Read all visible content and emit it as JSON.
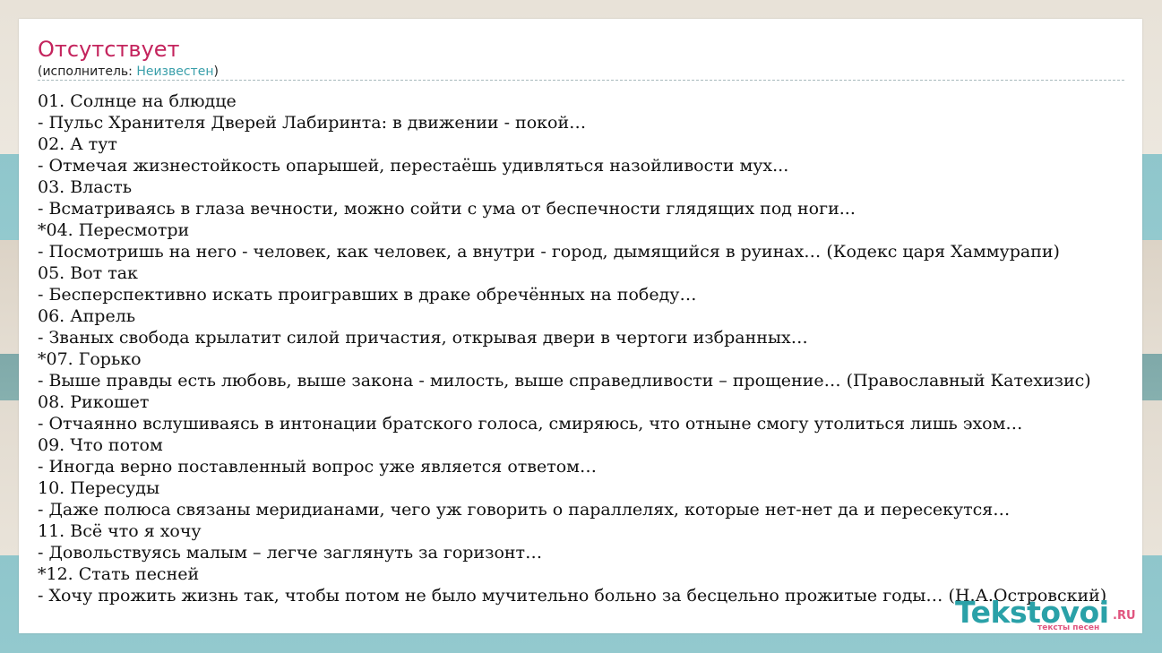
{
  "page": {
    "title": "Отсутствует",
    "artist_prefix": "(исполнитель: ",
    "artist_name": "Неизвестен",
    "artist_suffix": ")"
  },
  "tracks": [
    "01. Солнце на блюдце",
    "- Пульс Хранителя Дверей Лабиринта: в движении - покой…",
    "02. А тут",
    "- Отмечая жизнестойкость опарышей, перестаёшь удивляться назойливости мух...",
    "03. Власть",
    "- Всматриваясь в глаза вечности, можно сойти с ума от беспечности глядящих под ноги...",
    "*04. Пересмотри",
    "- Посмотришь на него - человек, как человек, а внутри - город, дымящийся в руинах… (Кодекс царя Хаммурапи)",
    "05. Вот так",
    "- Бесперспективно искать проигравших в драке обречённых на победу…",
    "06. Апрель",
    "- Званых свобода крылатит силой причастия, открывая двери в чертоги избранных…",
    "*07. Горько",
    "- Выше правды есть любовь, выше закона - милость, выше справедливости – прощение… (Православный Катехизис)",
    "08. Рикошет",
    "- Отчаянно вслушиваясь в интонации братского голоса, смиряюсь, что отныне смогу утолиться лишь эхом…",
    "09. Что потом",
    "- Иногда верно поставленный вопрос уже является ответом…",
    "10. Пересуды",
    "- Даже полюса связаны меридианами, чего уж говорить о параллелях, которые нет-нет да и пересекутся…",
    "11. Всё что я хочу",
    "- Довольствуясь малым – легче заглянуть за горизонт…",
    "*12. Стать песней",
    "- Хочу прожить жизнь так, чтобы потом не было мучительно больно за бесцельно прожитые годы… (Н.А.Островский)"
  ],
  "logo": {
    "name": "Tekstovoi",
    "tld": ".RU",
    "tagline": "тексты песен"
  },
  "colors": {
    "title": "#c4245d",
    "link": "#3a9faa",
    "logo_main": "#2aa1a8",
    "logo_accent": "#e0557f"
  }
}
